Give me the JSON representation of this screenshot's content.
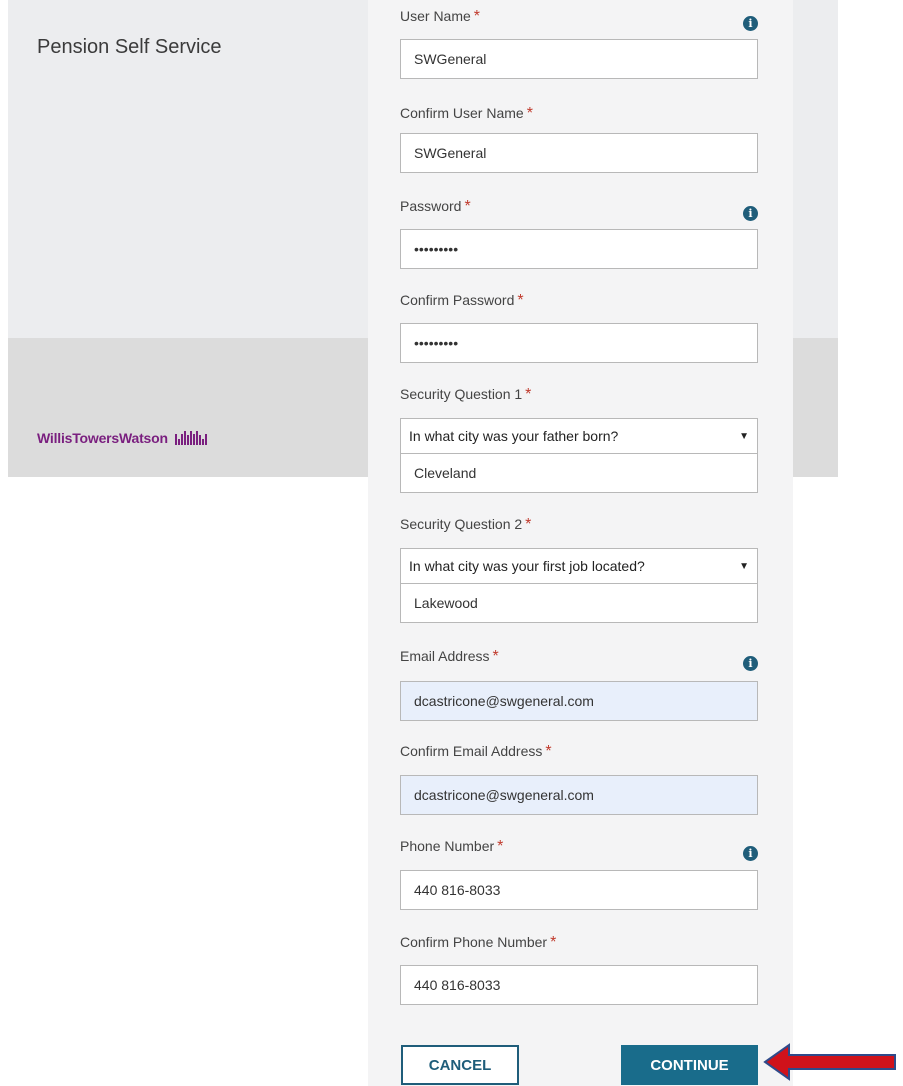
{
  "app": {
    "title": "Pension Self Service",
    "logo_text": "WillisTowersWatson"
  },
  "form": {
    "required_mark": "*",
    "info_glyph": "i",
    "select_arrow": "▼",
    "user_name": {
      "label": "User Name",
      "value": "SWGeneral"
    },
    "confirm_user_name": {
      "label": "Confirm User Name",
      "value": "SWGeneral"
    },
    "password": {
      "label": "Password",
      "value": "•••••••••"
    },
    "confirm_password": {
      "label": "Confirm Password",
      "value": "•••••••••"
    },
    "security_question_1": {
      "label": "Security Question 1",
      "question": "In what city was your father born?",
      "answer": "Cleveland"
    },
    "security_question_2": {
      "label": "Security Question 2",
      "question": "In what city was your first job located?",
      "answer": "Lakewood"
    },
    "email": {
      "label": "Email Address",
      "value": "dcastricone@swgeneral.com"
    },
    "confirm_email": {
      "label": "Confirm Email Address",
      "value": "dcastricone@swgeneral.com"
    },
    "phone": {
      "label": "Phone Number",
      "value": "440 816-8033"
    },
    "confirm_phone": {
      "label": "Confirm Phone Number",
      "value": "440 816-8033"
    }
  },
  "buttons": {
    "cancel": "CANCEL",
    "continue": "CONTINUE"
  },
  "colors": {
    "brand": "#7a1f7f",
    "accent": "#196c8b",
    "annotation_arrow": "#d0121b",
    "autofill": "#e8effb"
  }
}
